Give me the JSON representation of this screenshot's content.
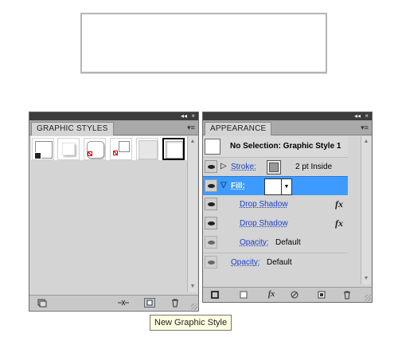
{
  "graphic_styles_panel": {
    "tab_label": "GRAPHIC STYLES",
    "collapse_glyph": "◂◂",
    "close_glyph": "×",
    "menu_glyph": "▾≡",
    "swatch_count": 6,
    "bottom_icons": [
      "graphic-style-libraries-icon",
      "break-link-icon",
      "new-graphic-style-icon",
      "delete-icon"
    ]
  },
  "appearance_panel": {
    "tab_label": "APPEARANCE",
    "collapse_glyph": "◂◂",
    "close_glyph": "×",
    "menu_glyph": "▾≡",
    "header_title": "No Selection: Graphic Style 1",
    "stroke": {
      "label": "Stroke:",
      "value": "2 pt  Inside"
    },
    "fill": {
      "label": "Fill:"
    },
    "effects": [
      {
        "label": "Drop Shadow",
        "fx": "fx"
      },
      {
        "label": "Drop Shadow",
        "fx": "fx"
      }
    ],
    "fill_opacity": {
      "label": "Opacity:",
      "value": "Default"
    },
    "object_opacity": {
      "label": "Opacity:",
      "value": "Default"
    },
    "bottom_fx": "fx",
    "bottom_icons": [
      "add-new-stroke-icon",
      "add-new-fill-icon",
      "add-new-effect-icon",
      "clear-appearance-icon",
      "duplicate-item-icon",
      "delete-item-icon"
    ]
  },
  "tooltip": {
    "text": "New Graphic Style"
  },
  "colors": {
    "selection_blue": "#3d9bff",
    "link_blue": "#1a3ec9",
    "panel_gray": "#d4d4d4"
  }
}
